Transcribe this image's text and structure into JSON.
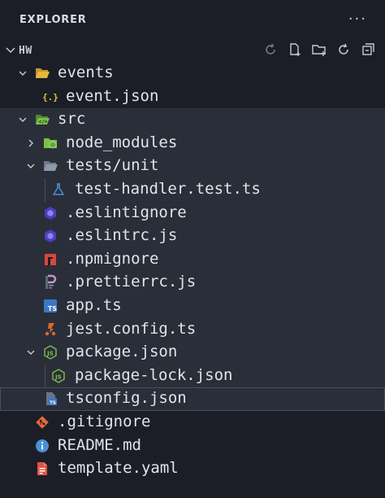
{
  "explorer": {
    "title": "EXPLORER",
    "more_icon": "ellipsis-icon",
    "root": {
      "label": "HW",
      "actions": [
        "refresh-icon",
        "new-file-icon",
        "new-folder-icon",
        "refresh-icon",
        "collapse-all-icon"
      ]
    }
  },
  "colors": {
    "background": "#1b1e26",
    "band": "#2a2e38",
    "folder_yellow": "#e8b63e",
    "folder_green": "#7cbf4a",
    "json_yellow": "#e5c33a",
    "eslint_purple": "#6b63d8",
    "npm_red": "#d9473d",
    "ts_blue": "#3a78c6",
    "jest_orange": "#d96a2e",
    "node_green": "#7cbf4a",
    "git_orange": "#e8693c",
    "info_blue": "#4a90d9"
  },
  "tree": [
    {
      "label": "events",
      "type": "folder",
      "icon": "folder-open-icon",
      "expanded": true
    },
    {
      "label": "event.json",
      "type": "file",
      "icon": "json-icon"
    },
    {
      "label": "src",
      "type": "folder",
      "icon": "folder-src-open-icon",
      "expanded": true
    },
    {
      "label": "node_modules",
      "type": "folder",
      "icon": "folder-node-icon",
      "expanded": false
    },
    {
      "label": "tests/unit",
      "type": "folder",
      "icon": "folder-open-icon",
      "expanded": true
    },
    {
      "label": "test-handler.test.ts",
      "type": "file",
      "icon": "flask-icon"
    },
    {
      "label": ".eslintignore",
      "type": "file",
      "icon": "eslint-icon"
    },
    {
      "label": ".eslintrc.js",
      "type": "file",
      "icon": "eslint-icon"
    },
    {
      "label": ".npmignore",
      "type": "file",
      "icon": "npm-icon"
    },
    {
      "label": ".prettierrc.js",
      "type": "file",
      "icon": "prettier-icon"
    },
    {
      "label": "app.ts",
      "type": "file",
      "icon": "typescript-icon"
    },
    {
      "label": "jest.config.ts",
      "type": "file",
      "icon": "jest-icon"
    },
    {
      "label": "package.json",
      "type": "file",
      "icon": "nodejs-icon",
      "expanded": true
    },
    {
      "label": "package-lock.json",
      "type": "file",
      "icon": "nodejs-icon"
    },
    {
      "label": "tsconfig.json",
      "type": "file",
      "icon": "tsconfig-icon"
    },
    {
      "label": ".gitignore",
      "type": "file",
      "icon": "git-icon"
    },
    {
      "label": "README.md",
      "type": "file",
      "icon": "info-icon"
    },
    {
      "label": "template.yaml",
      "type": "file",
      "icon": "yaml-icon"
    }
  ]
}
